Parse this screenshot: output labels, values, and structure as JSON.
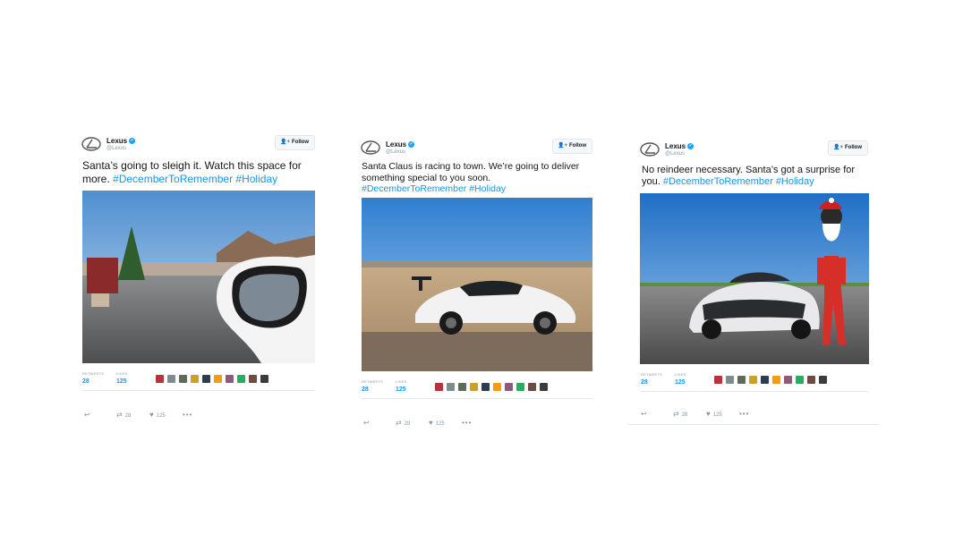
{
  "tweets": [
    {
      "name": "Lexus",
      "handle": "@Lexus",
      "follow_label": "Follow",
      "text_before": "Santa’s going to sleigh it. Watch this space for more. ",
      "hashtag1": "#DecemberToRemember",
      "hashtag2": "#Holiday",
      "retweets_label": "RETWEETS",
      "retweets": "28",
      "likes_label": "LIKES",
      "likes": "125",
      "action_retweets": "28",
      "action_likes": "125"
    },
    {
      "name": "Lexus",
      "handle": "@Lexus",
      "follow_label": "Follow",
      "text_before": "Santa Claus is racing to town. We’re going to deliver something special to you soon. ",
      "hashtag1": "#DecemberToRemember",
      "hashtag2": "#Holiday",
      "retweets_label": "RETWEETS",
      "retweets": "28",
      "likes_label": "LIKES",
      "likes": "125",
      "action_retweets": "28",
      "action_likes": "125"
    },
    {
      "name": "Lexus",
      "handle": "@Lexus",
      "follow_label": "Follow",
      "text_before": "No reindeer necessary. Santa’s got a surprise for you. ",
      "hashtag1": "#DecemberToRemember",
      "hashtag2": "#Holiday",
      "retweets_label": "RETWEETS",
      "retweets": "28",
      "likes_label": "LIKES",
      "likes": "125",
      "action_retweets": "28",
      "action_likes": "125"
    }
  ],
  "avatar_colors": [
    "#b8323a",
    "#7f8c8d",
    "#5d6d5a",
    "#c9a227",
    "#2c3e50",
    "#f39c12",
    "#8e5a7a",
    "#27ae60",
    "#6d4c41",
    "#3b3b3b"
  ],
  "icons": [
    "lexus-logo-icon",
    "verified-icon",
    "follow-person-icon",
    "reply-icon",
    "retweet-icon",
    "heart-icon",
    "more-icon"
  ]
}
